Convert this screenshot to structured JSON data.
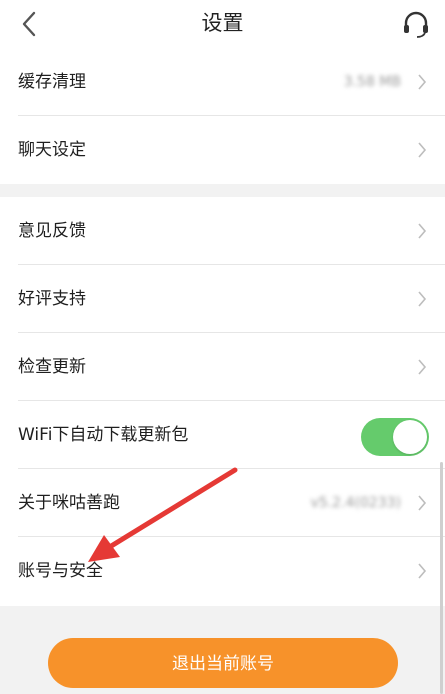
{
  "nav": {
    "title": "设置"
  },
  "group1": {
    "rows": [
      {
        "label": "缓存清理",
        "value": "3.58 MB"
      },
      {
        "label": "聊天设定"
      }
    ]
  },
  "group2": {
    "rows": [
      {
        "label": "意见反馈"
      },
      {
        "label": "好评支持"
      },
      {
        "label": "检查更新"
      },
      {
        "label": "WiFi下自动下载更新包",
        "toggle_on": true
      },
      {
        "label": "关于咪咕善跑",
        "value": "v5.2.4(0233)"
      },
      {
        "label": "账号与安全"
      }
    ]
  },
  "logout_label": "退出当前账号",
  "colors": {
    "accent_orange": "#f7922a",
    "toggle_green": "#65cb6c",
    "annotation_red": "#e53935"
  }
}
